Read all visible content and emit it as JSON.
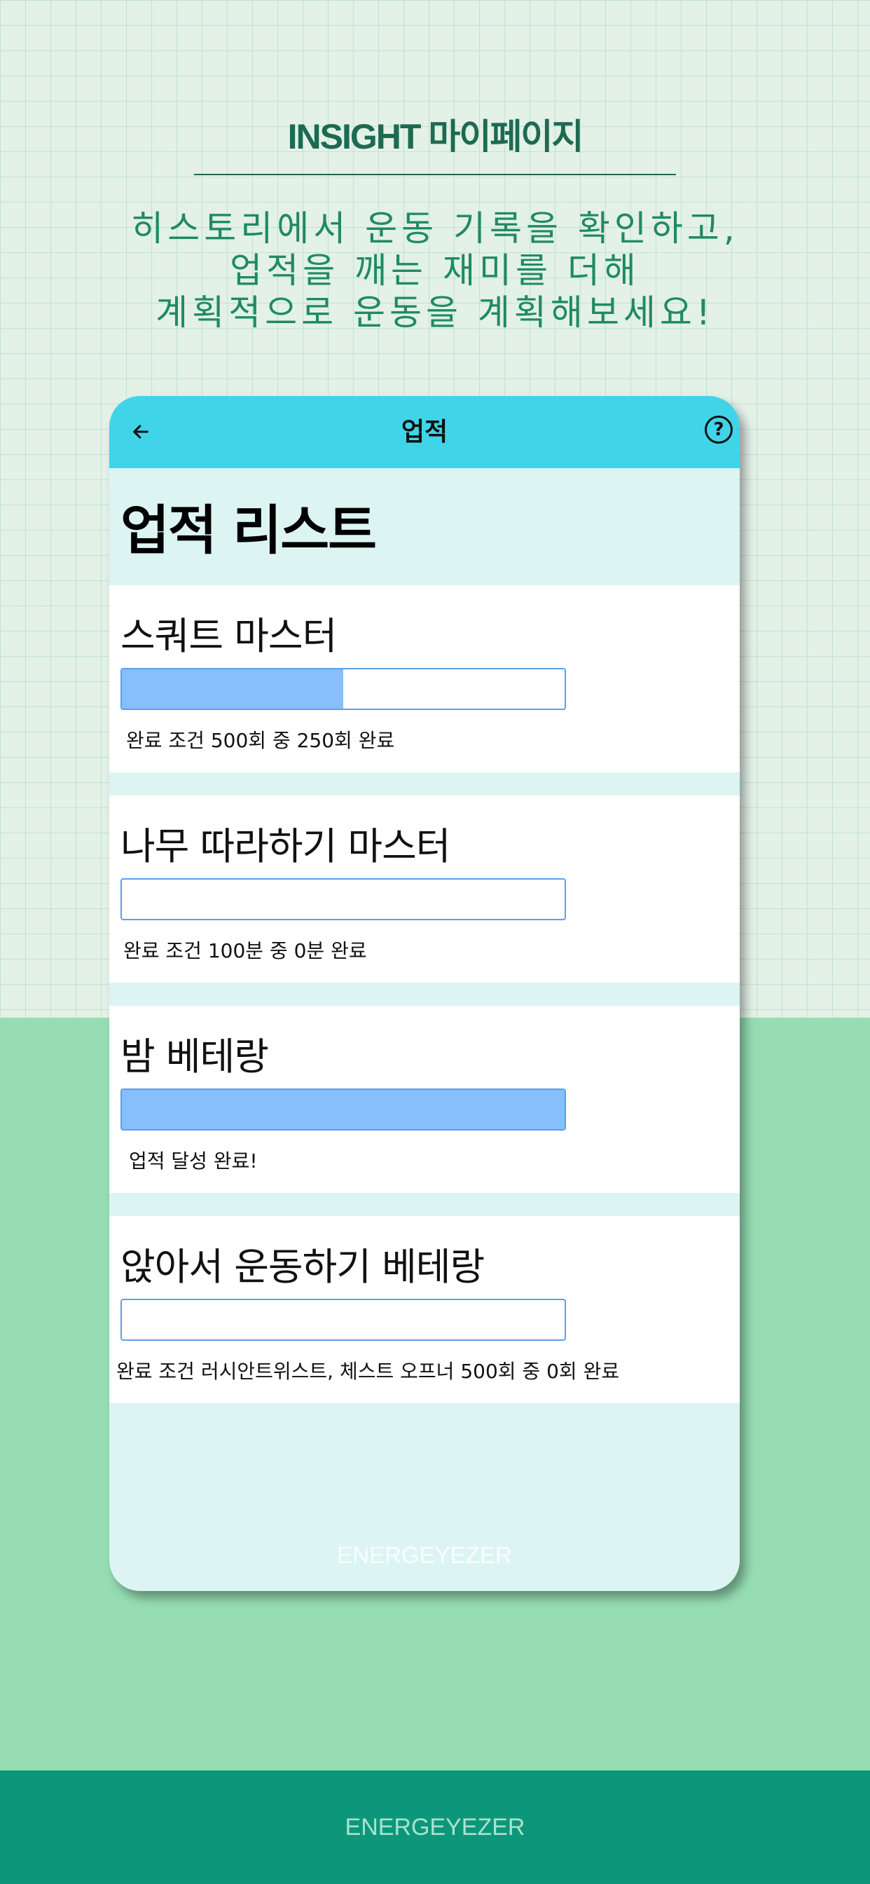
{
  "hero": {
    "title": "INSIGHT 마이페이지",
    "description_lines": [
      "히스토리에서 운동 기록을 확인하고,",
      "업적을 깨는 재미를 더해",
      "계획적으로 운동을 계획해보세요!"
    ]
  },
  "app": {
    "back_icon": "arrow-left-icon",
    "title": "업적",
    "help_icon": "question-circle-icon",
    "help_glyph": "?",
    "heading": "업적 리스트",
    "achievements": [
      {
        "title": "스쿼트 마스터",
        "progress": 0.5,
        "note": "완료 조건 500회 중 250회 완료"
      },
      {
        "title": "나무 따라하기 마스터",
        "progress": 0.0,
        "note": "완료 조건 100분 중 0분 완료"
      },
      {
        "title": "밤 베테랑",
        "progress": 1.0,
        "note": "업적 달성 완료!"
      },
      {
        "title": "앉아서 운동하기 베테랑",
        "progress": 0.0,
        "note": "완료 조건 러시안트위스트, 체스트 오프너 500회 중 0회 완료"
      }
    ],
    "watermark": "ENERGEYEZER"
  },
  "footer": {
    "brand": "ENERGEYEZER"
  },
  "colors": {
    "accent": "#40d4e8",
    "progress_fill": "#86bffb",
    "progress_border": "#5b9ef0",
    "footer": "#0d977a",
    "green_section": "#96ddb3",
    "hero_text": "#1f8a64"
  }
}
